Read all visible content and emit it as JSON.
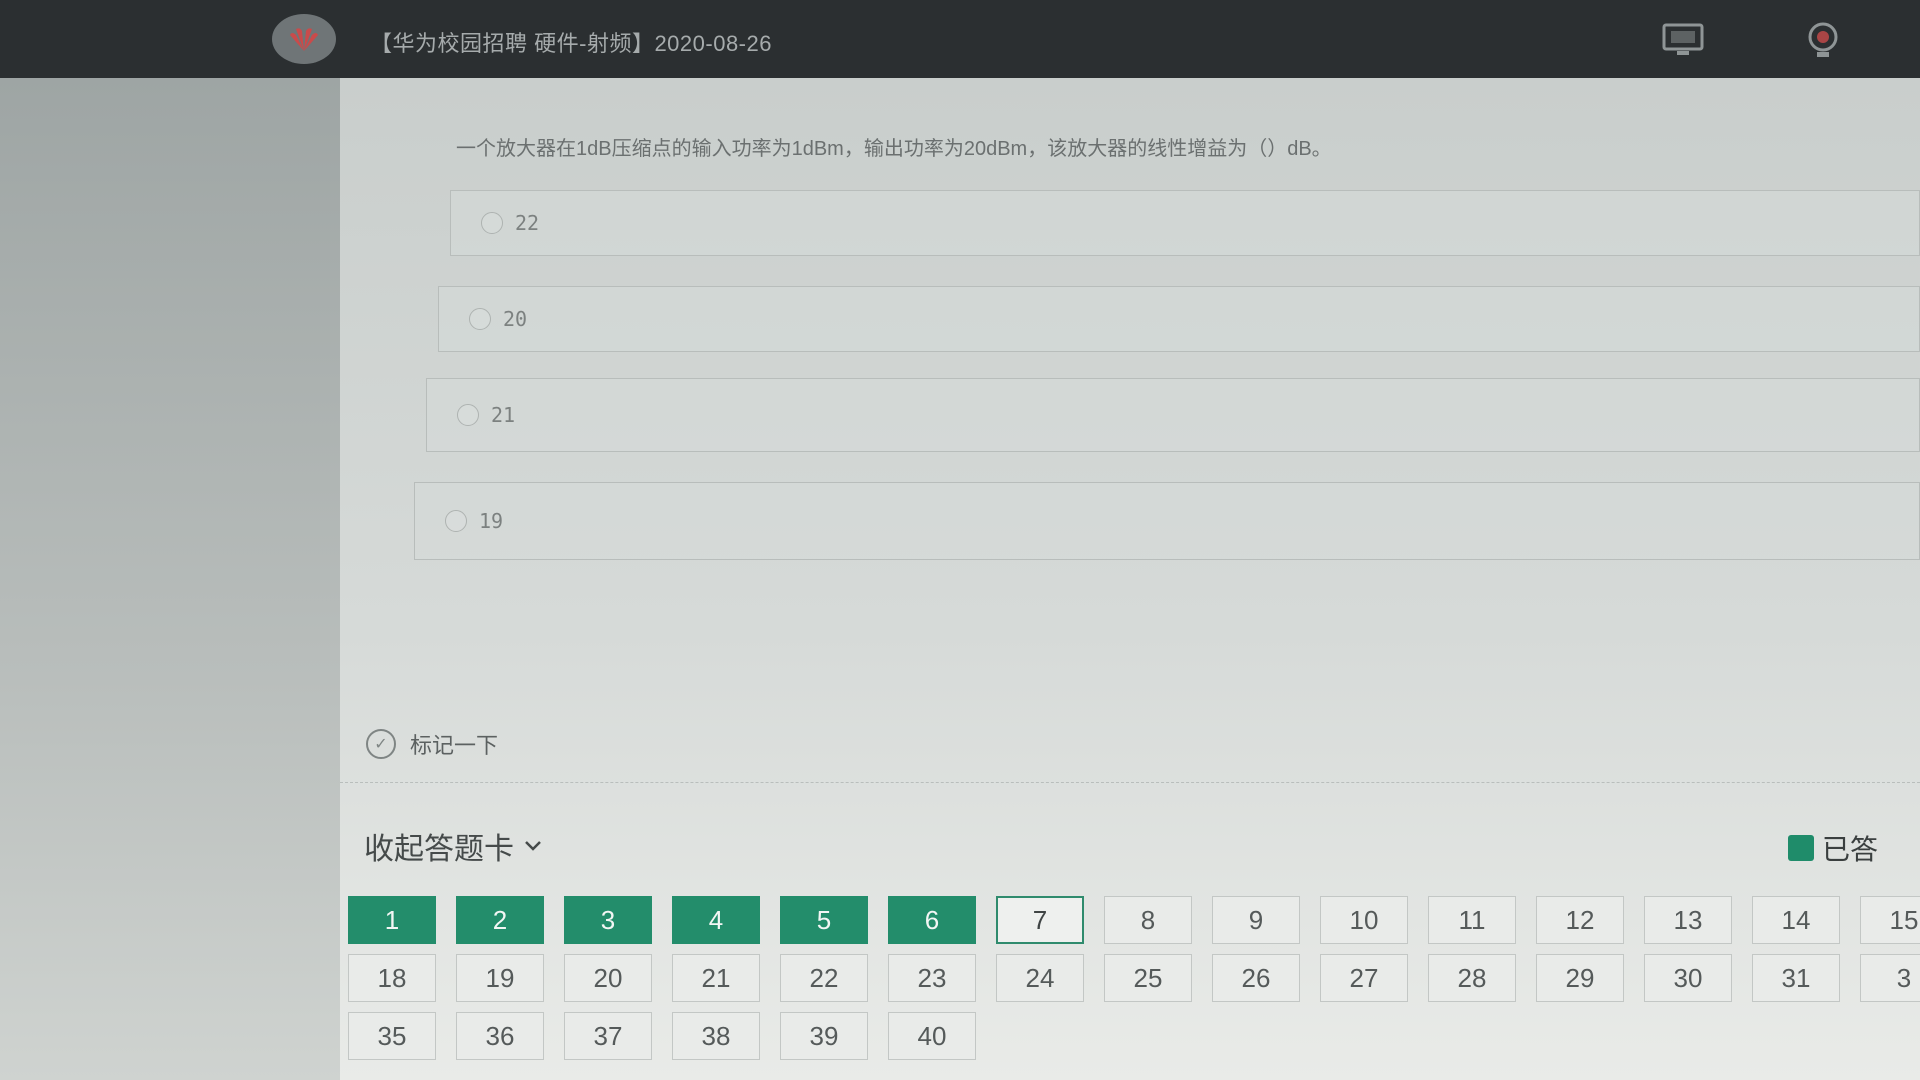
{
  "header": {
    "logo_icon": "huawei-logo-icon",
    "title": "【华为校园招聘 硬件-射频】2020-08-26",
    "icons": [
      "monitor-icon",
      "camera-icon"
    ]
  },
  "question": {
    "text": "一个放大器在1dB压缩点的输入功率为1dBm，输出功率为20dBm，该放大器的线性增益为（）dB。",
    "options": [
      {
        "label": "22"
      },
      {
        "label": "20"
      },
      {
        "label": "21"
      },
      {
        "label": "19"
      }
    ]
  },
  "mark": {
    "label": "标记一下",
    "icon": "flag-icon"
  },
  "answer_card": {
    "toggle_label": "收起答题卡",
    "legend_answered": "已答",
    "colors": {
      "answered": "#238d6b",
      "current_border": "#2f8b6d"
    },
    "current": 7,
    "row1": [
      "1",
      "2",
      "3",
      "4",
      "5",
      "6",
      "7",
      "8",
      "9",
      "10",
      "11",
      "12",
      "13",
      "14",
      "15"
    ],
    "row2": [
      "18",
      "19",
      "20",
      "21",
      "22",
      "23",
      "24",
      "25",
      "26",
      "27",
      "28",
      "29",
      "30",
      "31",
      "3"
    ],
    "row3": [
      "35",
      "36",
      "37",
      "38",
      "39",
      "40"
    ],
    "answered": [
      "1",
      "2",
      "3",
      "4",
      "5",
      "6"
    ]
  }
}
